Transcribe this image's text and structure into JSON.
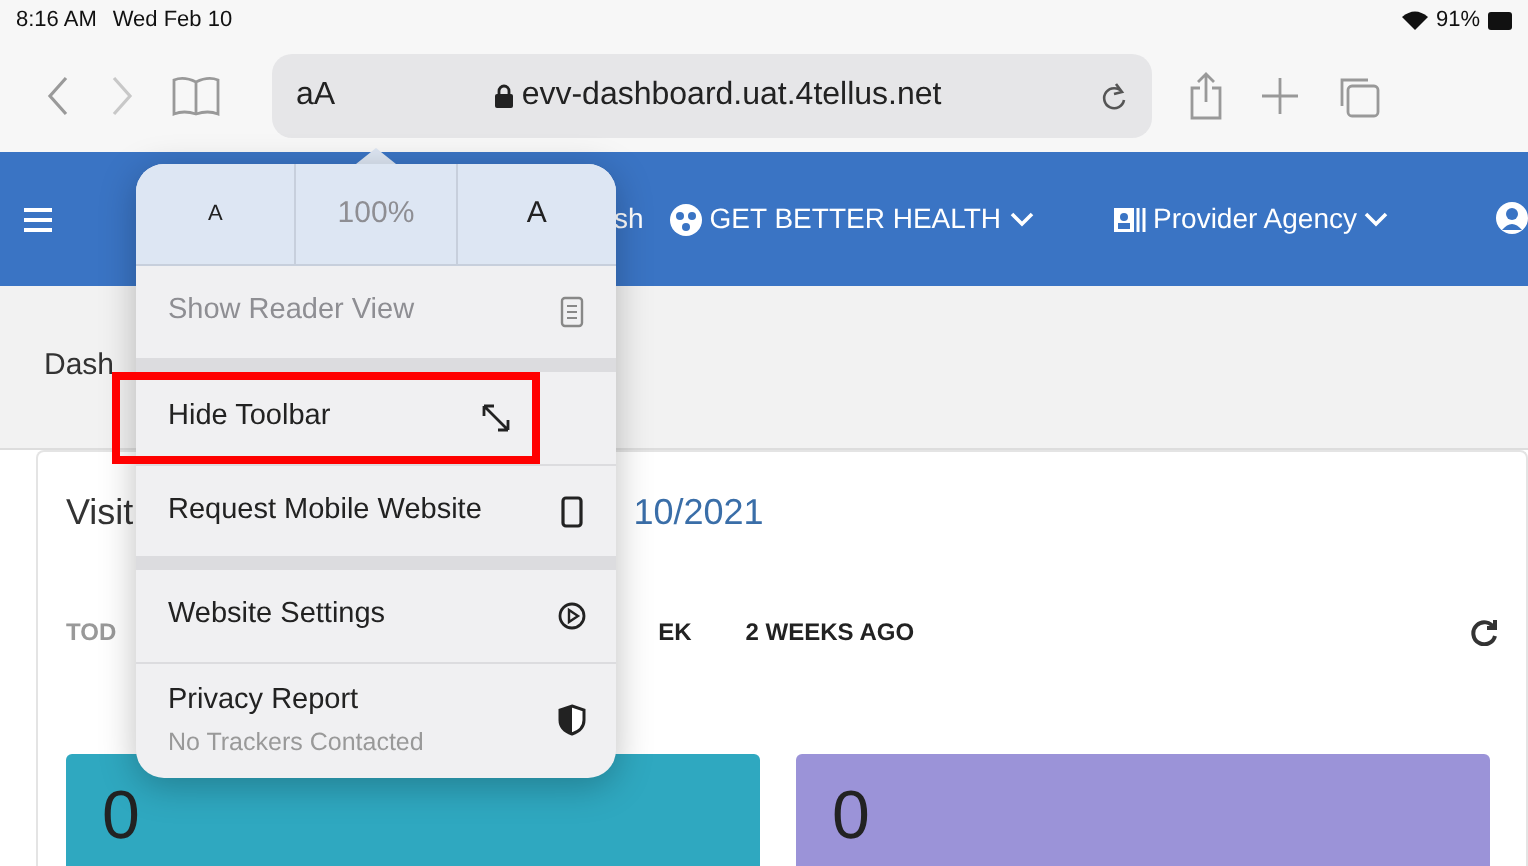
{
  "status_bar": {
    "time": "8:16 AM",
    "date": "Wed Feb 10",
    "battery": "91%"
  },
  "browser_toolbar": {
    "text_size_button": "aA",
    "url": "evv-dashboard.uat.4tellus.net"
  },
  "navbar": {
    "items": [
      {
        "label": "sh",
        "dropdown": false
      },
      {
        "label": "GET BETTER HEALTH",
        "dropdown": true
      },
      {
        "label": "Provider Agency",
        "dropdown": true
      }
    ]
  },
  "breadcrumb": "Dash",
  "card": {
    "title_start": "Visit",
    "title_end": "10/2021",
    "tabs": [
      {
        "label": "TOD",
        "muted": true
      },
      {
        "label": "EK",
        "muted": false
      },
      {
        "label": "2 WEEKS AGO",
        "muted": false
      }
    ],
    "tiles": [
      {
        "value": "0",
        "color": "#2fa8c0"
      },
      {
        "value": "0",
        "color": "#9b93d8"
      }
    ]
  },
  "popover": {
    "font_size": {
      "smaller": "A",
      "zoom": "100%",
      "larger": "A"
    },
    "sections": [
      [
        {
          "label": "Show Reader View",
          "disabled": true,
          "annotated": false
        }
      ],
      [
        {
          "label": "Hide Toolbar",
          "disabled": false,
          "annotated": true
        },
        {
          "label": "Request Mobile Website",
          "disabled": false,
          "annotated": false
        }
      ],
      [
        {
          "label": "Website Settings",
          "disabled": false,
          "annotated": false
        },
        {
          "label": "Privacy Report",
          "subtitle": "No Trackers Contacted",
          "disabled": false,
          "annotated": false
        }
      ]
    ]
  }
}
